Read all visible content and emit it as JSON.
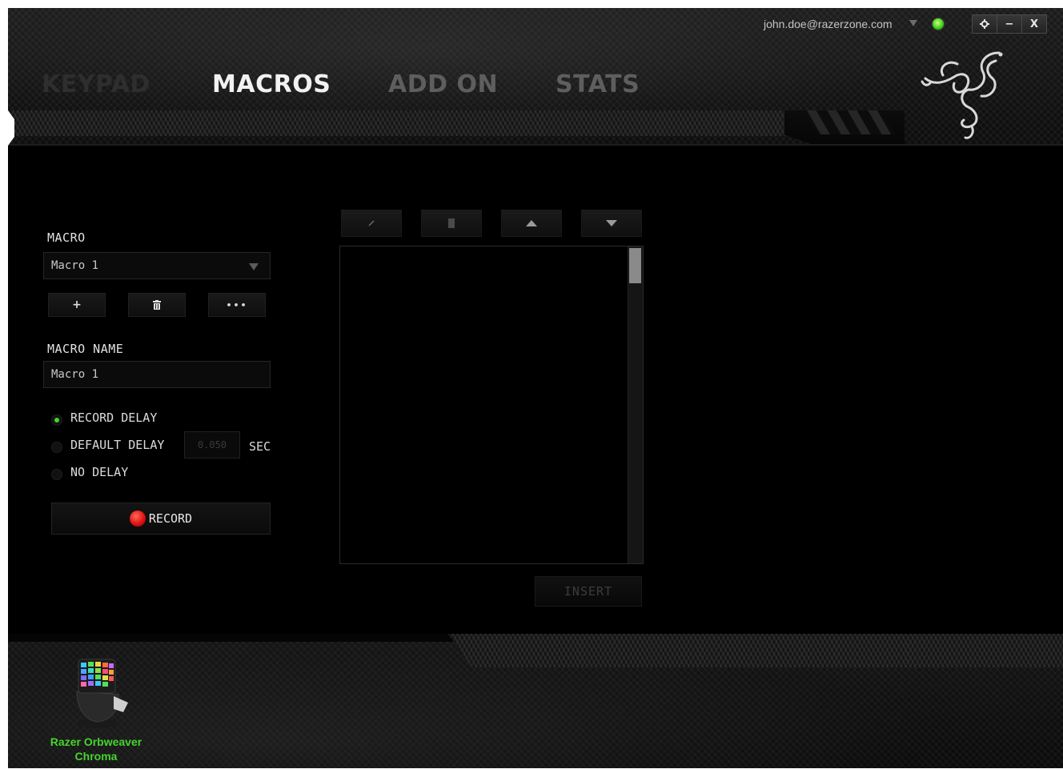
{
  "header": {
    "tabs": [
      {
        "label": "KEYPAD",
        "state": "inactive"
      },
      {
        "label": "MACROS",
        "state": "active"
      },
      {
        "label": "ADD ON",
        "state": "dim"
      },
      {
        "label": "STATS",
        "state": "dim"
      }
    ],
    "account": "john.doe@razerzone.com",
    "status_color": "#44d62c",
    "window_controls": {
      "settings_icon": "gear-icon",
      "minimize": "−",
      "close": "X"
    },
    "logo_icon": "razer-snake-logo"
  },
  "macro_panel": {
    "macro_label": "MACRO",
    "macro_selected": "Macro 1",
    "add_label": "+",
    "delete_icon": "trash-icon",
    "more_label": "•••",
    "macro_name_label": "MACRO NAME",
    "macro_name_value": "Macro 1",
    "delay_options": [
      {
        "label": "RECORD DELAY",
        "selected": true
      },
      {
        "label": "DEFAULT DELAY",
        "selected": false
      },
      {
        "label": "NO DELAY",
        "selected": false
      }
    ],
    "default_delay_value": "0.050",
    "delay_unit": "SEC",
    "record_label": "RECORD"
  },
  "editor": {
    "toolbar_icons": [
      "edit-icon",
      "trash-icon",
      "move-up-icon",
      "move-down-icon"
    ],
    "insert_label": "INSERT"
  },
  "footer": {
    "device_line1": "Razer Orbweaver",
    "device_line2": "Chroma"
  },
  "colors": {
    "accent": "#44d62c",
    "record": "#e01212",
    "background": "#000000"
  }
}
